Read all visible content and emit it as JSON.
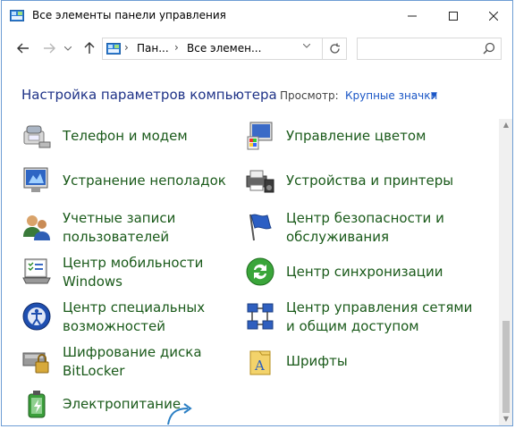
{
  "window": {
    "title": "Все элементы панели управления"
  },
  "nav": {
    "breadcrumbs": [
      "Пан...",
      "Все элемен..."
    ],
    "search_placeholder": ""
  },
  "header": {
    "title": "Настройка параметров компьютера",
    "view_label": "Просмотр:",
    "view_value": "Крупные значки"
  },
  "items": [
    {
      "label": "Телефон и модем",
      "icon": "phone-modem-icon"
    },
    {
      "label": "Управление цветом",
      "icon": "color-management-icon"
    },
    {
      "label": "Устранение неполадок",
      "icon": "troubleshooting-icon"
    },
    {
      "label": "Устройства и принтеры",
      "icon": "devices-printers-icon"
    },
    {
      "label": "Учетные записи пользователей",
      "icon": "user-accounts-icon"
    },
    {
      "label": "Центр безопасности и обслуживания",
      "icon": "security-maintenance-icon"
    },
    {
      "label": "Центр мобильности Windows",
      "icon": "mobility-center-icon"
    },
    {
      "label": "Центр синхронизации",
      "icon": "sync-center-icon"
    },
    {
      "label": "Центр специальных возможностей",
      "icon": "ease-of-access-icon"
    },
    {
      "label": "Центр управления сетями и общим доступом",
      "icon": "network-sharing-icon"
    },
    {
      "label": "Шифрование диска BitLocker",
      "icon": "bitlocker-icon"
    },
    {
      "label": "Шрифты",
      "icon": "fonts-icon"
    },
    {
      "label": "Электропитание",
      "icon": "power-options-icon"
    }
  ],
  "colors": {
    "title_blue": "#1e3287",
    "link_blue": "#1a56c6",
    "item_green": "#1a5a1a",
    "border": "#6d9dd4"
  }
}
